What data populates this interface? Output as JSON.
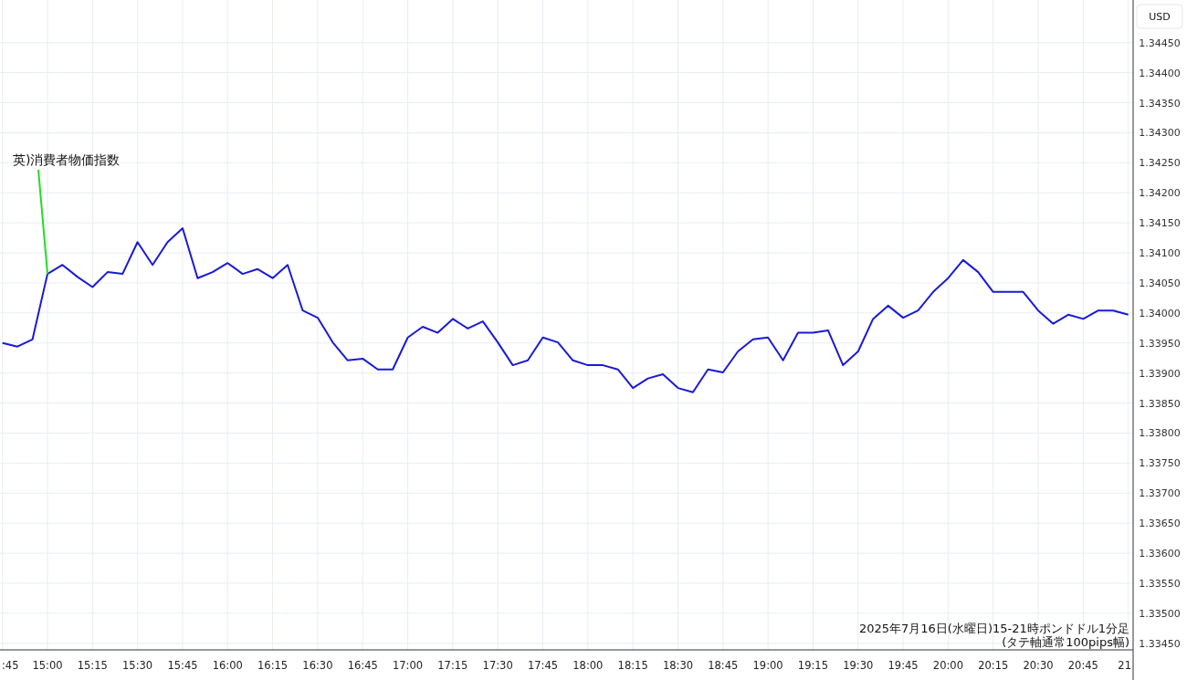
{
  "chart": {
    "price_axis": {
      "unit": "USD"
    },
    "caption": [
      "2025年7月16日(水曜日)15-21時ポンドドル1分足",
      "(タテ軸通常100pips幅)"
    ],
    "chart_data": {
      "type": "line",
      "grid": true,
      "ylim": [
        1.33439,
        1.34521
      ],
      "categories": [
        ":45",
        null,
        null,
        "15:00",
        null,
        null,
        "15:15",
        null,
        null,
        "15:30",
        null,
        null,
        "15:45",
        null,
        null,
        "16:00",
        null,
        null,
        "16:15",
        null,
        null,
        "16:30",
        null,
        null,
        "16:45",
        null,
        null,
        "17:00",
        null,
        null,
        "17:15",
        null,
        null,
        "17:30",
        null,
        null,
        "17:45",
        null,
        null,
        "18:00",
        null,
        null,
        "18:15",
        null,
        null,
        "18:30",
        null,
        null,
        "18:45",
        null,
        null,
        "19:00",
        null,
        null,
        "19:15",
        null,
        null,
        "19:30",
        null,
        null,
        "19:45",
        null,
        null,
        "20:00",
        null,
        null,
        "20:15",
        null,
        null,
        "20:30",
        null,
        null,
        "20:45",
        null,
        null,
        "21"
      ],
      "series": [
        {
          "color": "#1a1ad6",
          "values": [
            1.3395,
            1.33944,
            1.33956,
            1.34065,
            1.3408,
            1.3406,
            1.34043,
            1.34068,
            1.34065,
            1.34118,
            1.3408,
            1.34118,
            1.34141,
            1.34058,
            1.34068,
            1.34083,
            1.34065,
            1.34073,
            1.34058,
            1.3408,
            1.34004,
            1.33992,
            1.33951,
            1.33921,
            1.33924,
            1.33906,
            1.33906,
            1.33959,
            1.33977,
            1.33967,
            1.3399,
            1.33974,
            1.33986,
            1.33951,
            1.33913,
            1.33921,
            1.33959,
            1.33951,
            1.33921,
            1.33913,
            1.33913,
            1.33906,
            1.33875,
            1.33891,
            1.33898,
            1.33875,
            1.33868,
            1.33906,
            1.33901,
            1.33936,
            1.33956,
            1.33959,
            1.33921,
            1.33967,
            1.33967,
            1.33971,
            1.33913,
            1.33936,
            1.3399,
            1.34012,
            1.33992,
            1.34004,
            1.34035,
            1.34058,
            1.34088,
            1.34068,
            1.34035,
            1.34035,
            1.34035,
            1.34004,
            1.33982,
            1.33997,
            1.3399,
            1.34004,
            1.34004,
            1.33997
          ]
        }
      ],
      "yticks": [
        {
          "value": 1.3345,
          "label": "1.33450"
        },
        {
          "value": 1.335,
          "label": "1.33500"
        },
        {
          "value": 1.3355,
          "label": "1.33550"
        },
        {
          "value": 1.336,
          "label": "1.33600"
        },
        {
          "value": 1.3365,
          "label": "1.33650"
        },
        {
          "value": 1.337,
          "label": "1.33700"
        },
        {
          "value": 1.3375,
          "label": "1.33750"
        },
        {
          "value": 1.338,
          "label": "1.33800"
        },
        {
          "value": 1.3385,
          "label": "1.33850"
        },
        {
          "value": 1.339,
          "label": "1.33900"
        },
        {
          "value": 1.3395,
          "label": "1.33950"
        },
        {
          "value": 1.34,
          "label": "1.34000"
        },
        {
          "value": 1.3405,
          "label": "1.34050"
        },
        {
          "value": 1.341,
          "label": "1.34100"
        },
        {
          "value": 1.3415,
          "label": "1.34150"
        },
        {
          "value": 1.342,
          "label": "1.34200"
        },
        {
          "value": 1.3425,
          "label": "1.34250"
        },
        {
          "value": 1.343,
          "label": "1.34300"
        },
        {
          "value": 1.3435,
          "label": "1.34350"
        },
        {
          "value": 1.344,
          "label": "1.34400"
        },
        {
          "value": 1.3445,
          "label": "1.34450"
        }
      ],
      "annotations": [
        "英)消費者物価指数"
      ]
    }
  }
}
